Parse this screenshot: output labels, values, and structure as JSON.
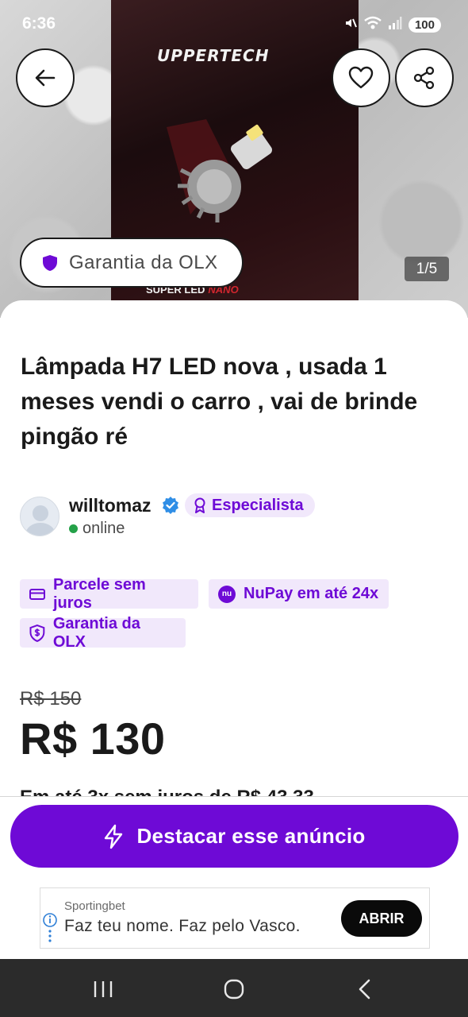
{
  "status_bar": {
    "time": "6:36",
    "battery": "100"
  },
  "hero": {
    "box_brand": "UPPERTECH",
    "box_line_a": "SUPER LED",
    "box_line_b": "NANO",
    "guarantee_label": "Garantia da OLX",
    "image_counter": "1/5",
    "back_icon": "arrow-left-icon",
    "favorite_icon": "heart-icon",
    "share_icon": "share-icon"
  },
  "listing": {
    "title": "Lâmpada H7  LED nova , usada 1 meses vendi o carro , vai de brinde pingão ré",
    "seller": {
      "name": "willtomaz",
      "badge": "Especialista",
      "status": "online"
    },
    "chips": [
      {
        "label": "Parcele sem juros",
        "icon": "card-icon"
      },
      {
        "label": "NuPay em até 24x",
        "icon": "nu-icon",
        "icon_text": "nu"
      },
      {
        "label": "Garantia da OLX",
        "icon": "shield-dollar-icon"
      }
    ],
    "old_price": "R$ 150",
    "price": "R$ 130",
    "installments_partial": "Em até 3x sem juros de R$ 43,33"
  },
  "cta": {
    "label": "Destacar esse anúncio",
    "icon": "lightning-icon"
  },
  "ad": {
    "advertiser": "Sportingbet",
    "text": "Faz teu nome. Faz pelo Vasco.",
    "button": "ABRIR"
  },
  "colors": {
    "brand_purple": "#6e0ad6",
    "chip_bg": "#f1e8fb",
    "online_green": "#24a148"
  }
}
